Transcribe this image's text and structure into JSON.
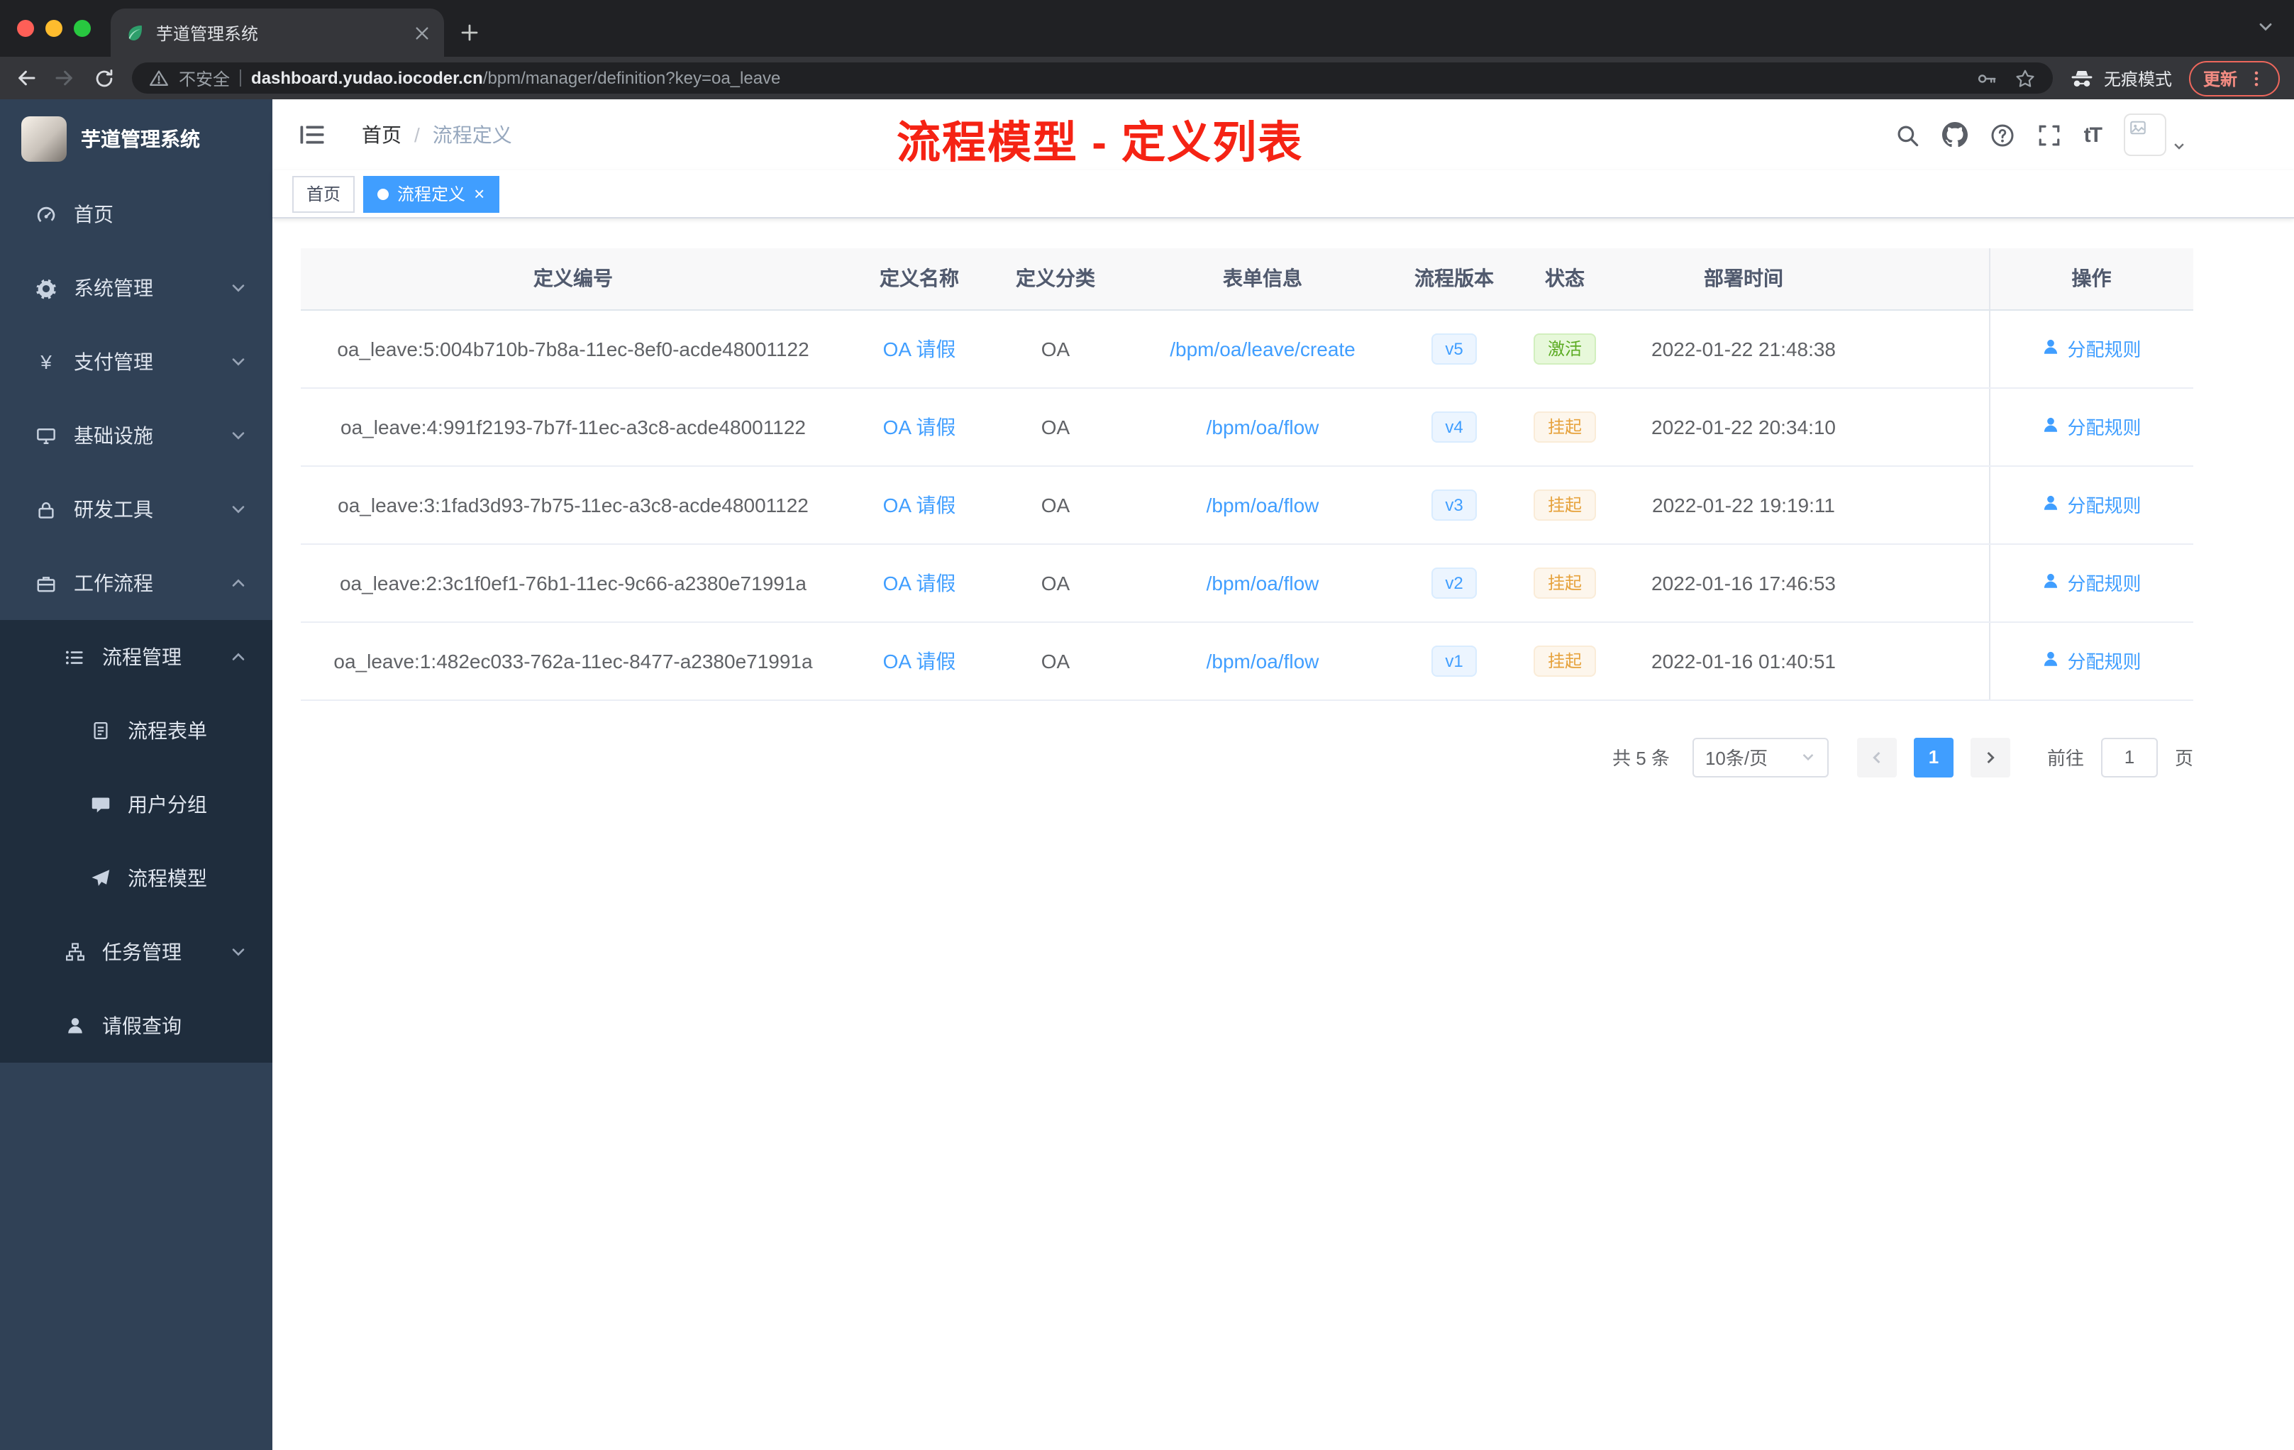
{
  "colors": {
    "accent": "#409eff",
    "success": "#67c23a",
    "warning": "#e6a23c",
    "annotation_red": "#f52314",
    "sidebar_bg": "#304156",
    "submenu_bg": "#1f2d3d",
    "active_tag": "#409eff"
  },
  "browser": {
    "tab_title": "芋道管理系统",
    "security_label": "不安全",
    "url_host": "dashboard.yudao.iocoder.cn",
    "url_path": "/bpm/manager/definition?key=oa_leave",
    "incognito_label": "无痕模式",
    "update_label": "更新"
  },
  "sidebar": {
    "logo_title": "芋道管理系统",
    "items": [
      {
        "label": "首页",
        "icon": "dashboard-icon"
      },
      {
        "label": "系统管理",
        "icon": "gear-icon"
      },
      {
        "label": "支付管理",
        "icon": "yen-icon"
      },
      {
        "label": "基础设施",
        "icon": "server-icon"
      },
      {
        "label": "研发工具",
        "icon": "lock-icon"
      },
      {
        "label": "工作流程",
        "icon": "briefcase-icon"
      },
      {
        "label": "流程管理",
        "icon": "list-icon"
      },
      {
        "label": "流程表单",
        "icon": "document-icon"
      },
      {
        "label": "用户分组",
        "icon": "chat-icon"
      },
      {
        "label": "流程模型",
        "icon": "paper-plane-icon"
      },
      {
        "label": "任务管理",
        "icon": "org-tree-icon"
      },
      {
        "label": "请假查询",
        "icon": "user-icon"
      }
    ]
  },
  "navbar": {
    "breadcrumb_home": "首页",
    "breadcrumb_separator": "/",
    "breadcrumb_current": "流程定义",
    "annotation": "流程模型 - 定义列表"
  },
  "tags": {
    "home": "首页",
    "current": "流程定义"
  },
  "table": {
    "columns": [
      "定义编号",
      "定义名称",
      "定义分类",
      "表单信息",
      "流程版本",
      "状态",
      "部署时间",
      "操作"
    ],
    "rows": [
      {
        "id": "oa_leave:5:004b710b-7b8a-11ec-8ef0-acde48001122",
        "name": "OA 请假",
        "category": "OA",
        "form": "/bpm/oa/leave/create",
        "version": "v5",
        "status": "激活",
        "time": "2022-01-22 21:48:38",
        "action": "分配规则"
      },
      {
        "id": "oa_leave:4:991f2193-7b7f-11ec-a3c8-acde48001122",
        "name": "OA 请假",
        "category": "OA",
        "form": "/bpm/oa/flow",
        "version": "v4",
        "status": "挂起",
        "time": "2022-01-22 20:34:10",
        "action": "分配规则"
      },
      {
        "id": "oa_leave:3:1fad3d93-7b75-11ec-a3c8-acde48001122",
        "name": "OA 请假",
        "category": "OA",
        "form": "/bpm/oa/flow",
        "version": "v3",
        "status": "挂起",
        "time": "2022-01-22 19:19:11",
        "action": "分配规则"
      },
      {
        "id": "oa_leave:2:3c1f0ef1-76b1-11ec-9c66-a2380e71991a",
        "name": "OA 请假",
        "category": "OA",
        "form": "/bpm/oa/flow",
        "version": "v2",
        "status": "挂起",
        "time": "2022-01-16 17:46:53",
        "action": "分配规则"
      },
      {
        "id": "oa_leave:1:482ec033-762a-11ec-8477-a2380e71991a",
        "name": "OA 请假",
        "category": "OA",
        "form": "/bpm/oa/flow",
        "version": "v1",
        "status": "挂起",
        "time": "2022-01-16 01:40:51",
        "action": "分配规则"
      }
    ]
  },
  "pagination": {
    "total": "共 5 条",
    "page_size": "10条/页",
    "page": "1",
    "goto_label": "前往",
    "goto_value": "1",
    "unit_label": "页"
  },
  "icons": {
    "favicon": "leaf",
    "security": "warning-triangle",
    "omnibox_right": [
      "key",
      "star"
    ],
    "toolbar": [
      "incognito",
      "kebab-dots"
    ],
    "sidebar": [
      "dashboard",
      "gear",
      "yen",
      "server",
      "lock",
      "briefcase",
      "list",
      "document",
      "chat",
      "paper-plane",
      "org-tree",
      "user"
    ],
    "navbar_right": [
      "search",
      "github",
      "question-circle",
      "fullscreen",
      "font-size",
      "avatar",
      "chevron-down"
    ],
    "table_action": "user",
    "pagination": [
      "chevron-left",
      "chevron-right",
      "chevron-down"
    ]
  }
}
